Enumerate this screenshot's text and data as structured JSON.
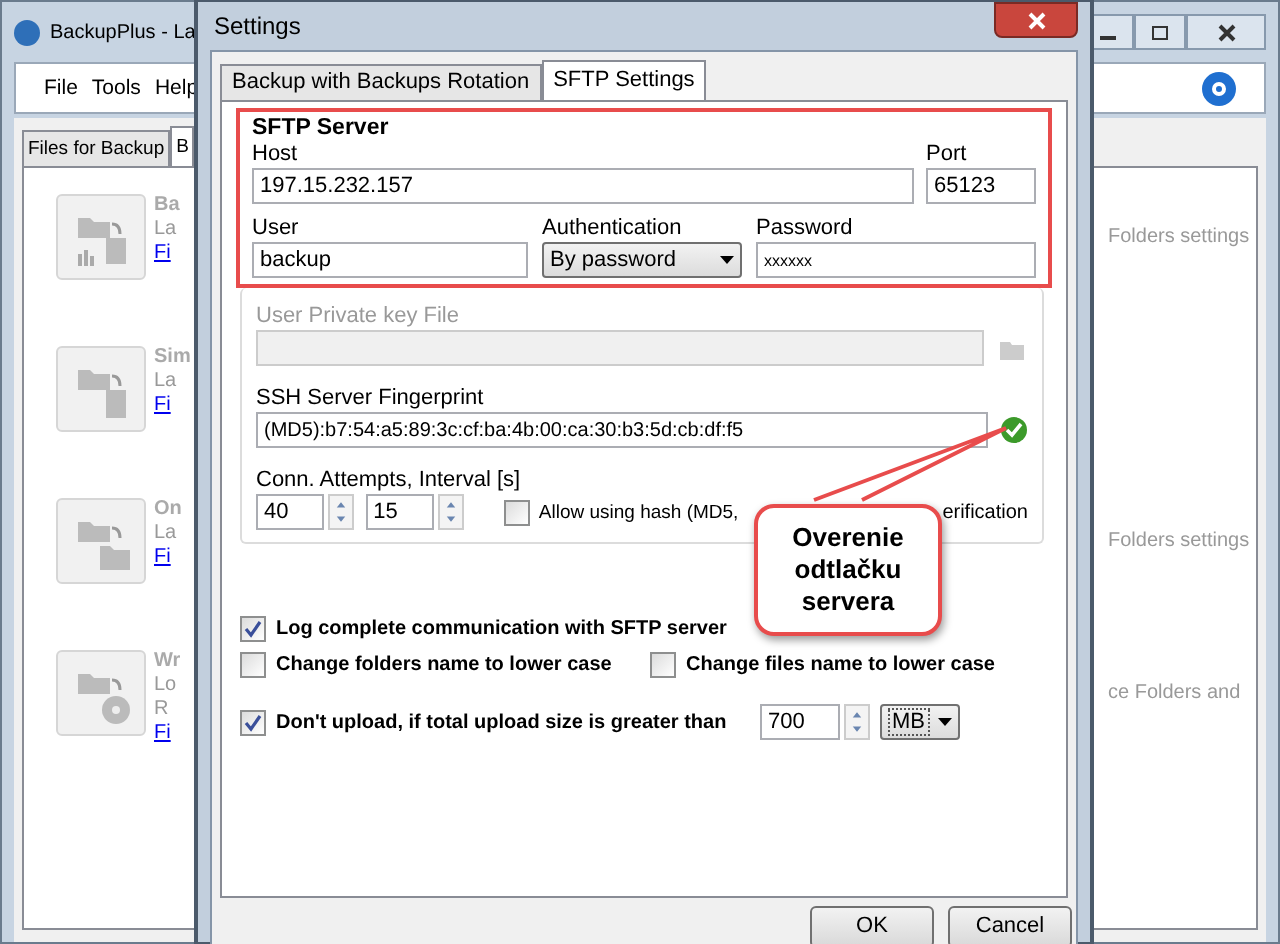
{
  "main_window": {
    "title": "BackupPlus - La",
    "menu": [
      "File",
      "Tools",
      "Help"
    ],
    "tabs": [
      {
        "label": "Files for Backup",
        "selected": false
      },
      {
        "label": "B",
        "selected": true
      }
    ],
    "tasks": [
      {
        "kind": "chart",
        "lines": [
          "Ba",
          "La"
        ],
        "link": "Fi",
        "note": "Folders settings"
      },
      {
        "kind": "document",
        "lines": [
          "Sim",
          "La"
        ],
        "link": "Fi"
      },
      {
        "kind": "folder",
        "lines": [
          "On",
          "La"
        ],
        "link": "Fi",
        "note": "Folders settings"
      },
      {
        "kind": "disc",
        "lines": [
          "Wr",
          "Lo",
          "R"
        ],
        "link": "Fi",
        "note": "ce Folders and"
      }
    ]
  },
  "dialog": {
    "title": "Settings",
    "tabs": [
      {
        "label": "Backup with Backups Rotation",
        "selected": false
      },
      {
        "label": "SFTP Settings",
        "selected": true
      }
    ],
    "sftp_server": {
      "title": "SFTP Server",
      "host_label": "Host",
      "host": "197.15.232.157",
      "port_label": "Port",
      "port": "65123",
      "user_label": "User",
      "user": "backup",
      "auth_label": "Authentication",
      "auth": "By password",
      "password_label": "Password",
      "password": "xxxxxx"
    },
    "private_key": {
      "label": "User Private key File",
      "disabled": true
    },
    "fingerprint": {
      "label": "SSH Server Fingerprint",
      "value": "(MD5):b7:54:a5:89:3c:cf:ba:4b:00:ca:30:b3:5d:cb:df:f5",
      "verified": true
    },
    "conn": {
      "label": "Conn. Attempts, Interval [s]",
      "attempts": "40",
      "interval": "15",
      "allow_hash_label_start": "Allow using hash (MD5,",
      "allow_hash_label_end": "erification",
      "allow_hash_checked": false
    },
    "callout": "Overenie odtlačku servera",
    "options": [
      {
        "label": "Log complete communication with SFTP server",
        "checked": true
      },
      {
        "label": "Change folders name to lower case",
        "checked": false
      },
      {
        "label": "Change files name to lower case",
        "checked": false
      },
      {
        "label": "Don't upload, if total upload size is greater than",
        "checked": true
      }
    ],
    "size_limit": "700",
    "size_unit": "MB",
    "buttons": [
      "OK",
      "Cancel"
    ]
  }
}
